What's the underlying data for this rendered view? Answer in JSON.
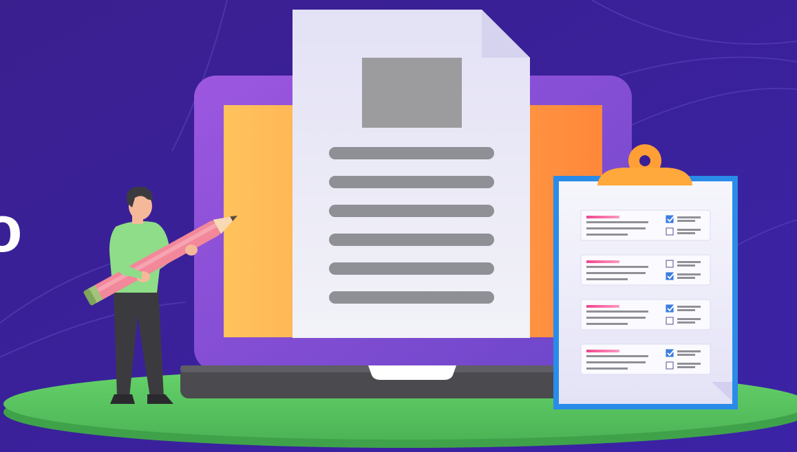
{
  "illustration": {
    "partial_text": "o",
    "colors": {
      "background": "#3a1f95",
      "laptop_frame": "#8a4fd6",
      "screen_gradient_start": "#ffc25a",
      "screen_gradient_end": "#ff8a3d",
      "document": "#ececf6",
      "document_lines": "#8f8f96",
      "image_placeholder": "#9c9c9f",
      "clipboard_frame": "#2d8be6",
      "clipboard_paper": "#eef0fb",
      "clip": "#ffa33a",
      "platform": "#5dca62",
      "pencil": "#f48a9a",
      "shirt": "#8fe08a",
      "pants": "#3a3a3a",
      "accent_pink": "#f0458f",
      "check_blue": "#3c7ee0"
    },
    "clipboard_cards": [
      {
        "checks": [
          true,
          false
        ]
      },
      {
        "checks": [
          false,
          true
        ]
      },
      {
        "checks": [
          true,
          false
        ]
      },
      {
        "checks": [
          true,
          false
        ]
      }
    ],
    "document_line_count": 6,
    "icons": [
      "document-icon",
      "laptop-icon",
      "clipboard-icon",
      "pencil-icon",
      "person-icon",
      "checkbox-icon"
    ]
  }
}
